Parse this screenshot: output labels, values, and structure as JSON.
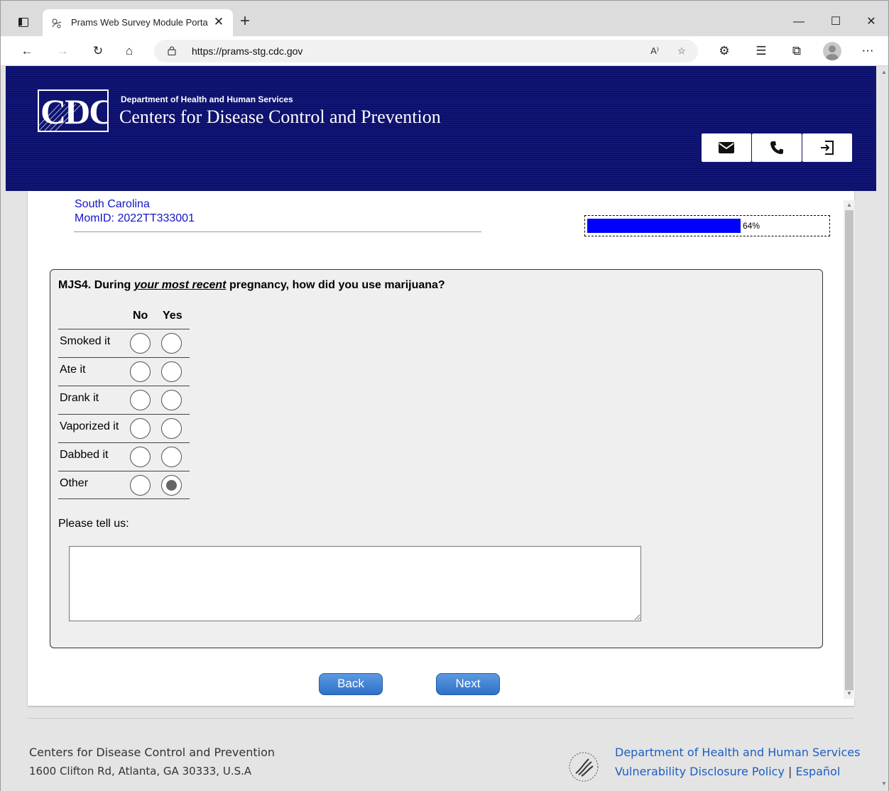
{
  "browser": {
    "tab_title": "Prams Web Survey Module Porta",
    "url": "https://prams-stg.cdc.gov"
  },
  "header": {
    "logo_text": "CDC",
    "dept_small": "Department of Health and Human Services",
    "dept_large": "Centers for Disease Control and Prevention",
    "buttons": [
      "mail-icon",
      "phone-icon",
      "logout-icon"
    ],
    "banner_color": "#0b0f6e"
  },
  "respondent": {
    "state": "South Carolina",
    "momid": "MomID: 2022TT333001"
  },
  "progress": {
    "value": 64,
    "label": "64%",
    "fill_color": "#0000ff"
  },
  "question": {
    "prefix": "MJS4. During ",
    "emphasis": "your most recent",
    "suffix": " pregnancy, how did you use marijuana?",
    "col_no": "No",
    "col_yes": "Yes",
    "rows": [
      {
        "label": "Smoked it",
        "answer": null
      },
      {
        "label": "Ate it",
        "answer": null
      },
      {
        "label": "Drank it",
        "answer": null
      },
      {
        "label": "Vaporized it",
        "answer": null
      },
      {
        "label": "Dabbed it",
        "answer": null
      },
      {
        "label": "Other",
        "answer": "Yes"
      }
    ],
    "tell_label": "Please tell us:",
    "tell_value": ""
  },
  "nav": {
    "back": "Back",
    "next": "Next",
    "button_color": "#3a7bd5"
  },
  "footer": {
    "org": "Centers for Disease Control and Prevention",
    "address": "1600 Clifton Rd, Atlanta, GA 30333, U.S.A",
    "hhs_link": "Department of Health and Human Services",
    "vdp_link": "Vulnerability Disclosure Policy",
    "separator": "|",
    "espanol_link": "Español",
    "link_color": "#1a5fc4"
  }
}
